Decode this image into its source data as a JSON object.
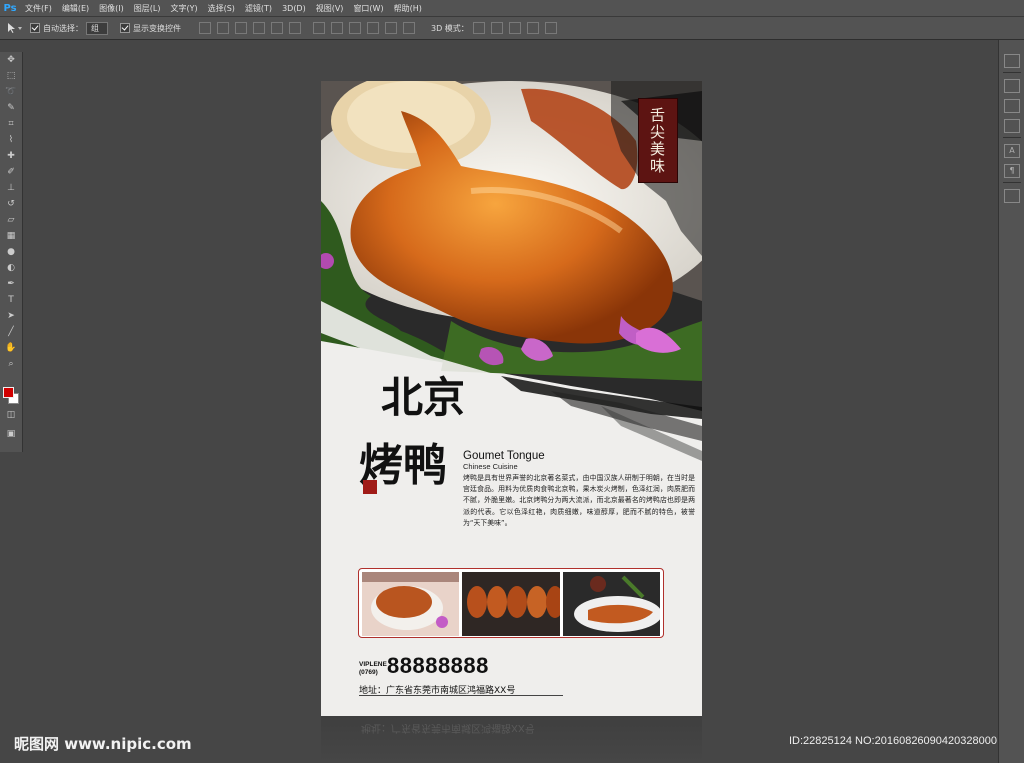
{
  "app": {
    "logo": "Ps"
  },
  "menu": [
    "文件(F)",
    "编辑(E)",
    "图像(I)",
    "图层(L)",
    "文字(Y)",
    "选择(S)",
    "滤镜(T)",
    "3D(D)",
    "视图(V)",
    "窗口(W)",
    "帮助(H)"
  ],
  "options": {
    "auto_select_label": "自动选择：",
    "auto_select_value": "组",
    "show_transform_label": "显示变换控件",
    "mode_3d_label": "3D 模式："
  },
  "poster": {
    "seal_text": "舌尖美味",
    "title_line1": "北京",
    "title_line2": "烤鸭",
    "en_title": "Goumet Tongue",
    "en_subtitle": "Chinese  Cuisine",
    "description": "烤鸭是具有世界声誉的北京著名菜式，由中国汉族人研制于明朝，在当时是宫廷食品。用料为优质肉食鸭北京鸭，果木炭火烤制，色泽红润，肉质肥而不腻，外脆里嫩。北京烤鸭分为两大流派，而北京最著名的烤鸭店也即是两派的代表。它以色泽红艳，肉质细嫩，味道醇厚，肥而不腻的特色，被誉为“天下美味”。",
    "tel_label_1": "VIPLENE",
    "tel_label_2": "(0769)",
    "tel_number": "88888888",
    "address": "地址：广东省东莞市南城区鸿福路XX号"
  },
  "watermark": {
    "left": "昵图网 www.nipic.com",
    "right": "ID:22825124 NO:20160826090420328000"
  },
  "colors": {
    "accent_red": "#a01b17",
    "seal_bg": "#5d1412",
    "ps_blue": "#31a8ff"
  }
}
